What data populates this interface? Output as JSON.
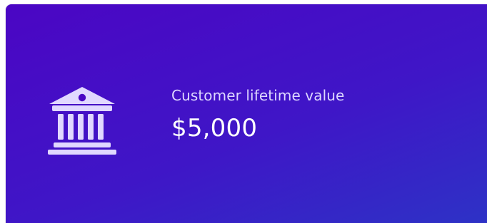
{
  "card": {
    "label": "Customer lifetime value",
    "value": "$5,000",
    "icon": "bank-icon",
    "colors": {
      "gradient_start": "#4b06c4",
      "gradient_mid": "#3f16c7",
      "gradient_end": "#2c34c6",
      "label": "#ddd7ff",
      "value": "#ffffff",
      "icon_fill": "#e1d8ff"
    }
  }
}
